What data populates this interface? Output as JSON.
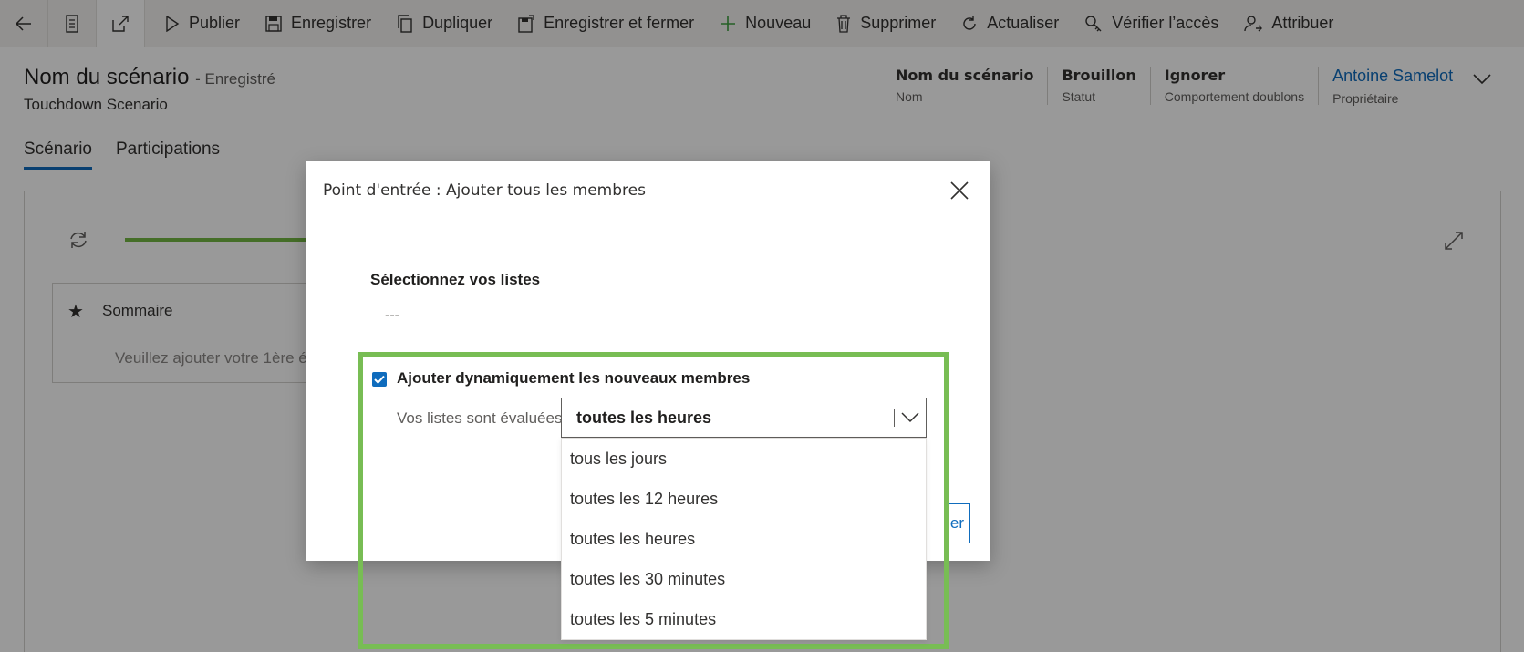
{
  "toolbar": {
    "publish": "Publier",
    "save": "Enregistrer",
    "duplicate": "Dupliquer",
    "save_close": "Enregistrer et fermer",
    "new": "Nouveau",
    "delete": "Supprimer",
    "refresh": "Actualiser",
    "check_access": "Vérifier l’accès",
    "assign": "Attribuer"
  },
  "header": {
    "title": "Nom du scénario",
    "save_status": "- Enregistré",
    "subtitle": "Touchdown Scenario",
    "fields": [
      {
        "value": "Nom du scénario",
        "label": "Nom"
      },
      {
        "value": "Brouillon",
        "label": "Statut"
      },
      {
        "value": "Ignorer",
        "label": "Comportement doublons"
      },
      {
        "value": "Antoine Samelot",
        "label": "Propriétaire"
      }
    ]
  },
  "tabs": [
    "Scénario",
    "Participations"
  ],
  "canvas": {
    "summary_label": "Sommaire",
    "summary_hint": "Veuillez ajouter votre 1ère é"
  },
  "dialog": {
    "title": "Point d'entrée : Ajouter tous les membres",
    "select_lists_label": "Sélectionnez vos listes",
    "select_lists_value": "---",
    "dynamic_checkbox_label": "Ajouter dynamiquement les nouveaux membres",
    "dynamic_checked": true,
    "evaluation_label": "Vos listes sont évaluées",
    "frequency_selected": "toutes les heures",
    "frequency_options": [
      "tous les jours",
      "toutes les 12 heures",
      "toutes les heures",
      "toutes les 30 minutes",
      "toutes les 5 minutes"
    ],
    "button_partial_label": "ler"
  },
  "colors": {
    "accent": "#0f6cbd",
    "highlight": "#78bd54",
    "progress": "#74b843"
  }
}
